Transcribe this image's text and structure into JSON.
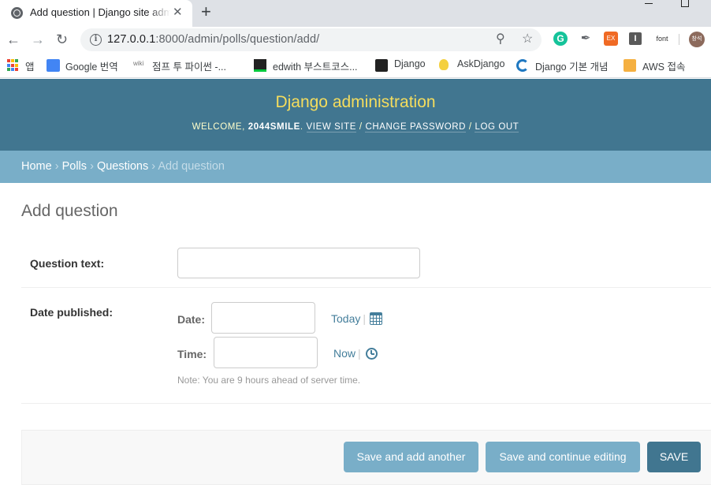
{
  "browser": {
    "tab_title": "Add question | Django site admin",
    "tab_close": "✕",
    "new_tab": "+",
    "url_host": "127.0.0.1",
    "url_rest": ":8000/admin/polls/question/add/",
    "ext_g": "G",
    "ext_ex": "EX",
    "ext_i": "I",
    "ext_font": "font",
    "avatar_text": "창석"
  },
  "bookmarks": [
    {
      "label": "앱",
      "icon": "apps-grid-icon"
    },
    {
      "label": "Google 번역",
      "icon": "google-translate-icon"
    },
    {
      "label": "점프 투 파이썬 -...",
      "icon": "wiki-icon"
    },
    {
      "label": "edwith 부스트코스...",
      "icon": "edwith-icon"
    },
    {
      "label": "Django",
      "icon": "django-icon"
    },
    {
      "label": "AskDjango",
      "icon": "lightbulb-icon"
    },
    {
      "label": "Django 기본 개념",
      "icon": "c-logo-icon"
    },
    {
      "label": "AWS 접속",
      "icon": "aws-box-icon"
    }
  ],
  "admin": {
    "site_title": "Django administration",
    "welcome": "Welcome,",
    "username": "2044smile",
    "view_site": "View site",
    "change_password": "Change password",
    "log_out": "Log out",
    "sep": "/"
  },
  "breadcrumbs": {
    "home": "Home",
    "app": "Polls",
    "model": "Questions",
    "current": "Add question",
    "sep": "›"
  },
  "form": {
    "title": "Add question",
    "question_text_label": "Question text:",
    "question_text_value": "",
    "date_published_label": "Date published:",
    "date_label": "Date:",
    "date_value": "",
    "today_link": "Today",
    "time_label": "Time:",
    "time_value": "",
    "now_link": "Now",
    "pipe": "|",
    "timezone_note": "Note: You are 9 hours ahead of server time."
  },
  "actions": {
    "save_add_another": "Save and add another",
    "save_continue": "Save and continue editing",
    "save": "Save"
  },
  "colors": {
    "header_bg": "#417690",
    "breadcrumb_bg": "#79aec8",
    "branding": "#f5dd5d",
    "link": "#447e9b"
  }
}
